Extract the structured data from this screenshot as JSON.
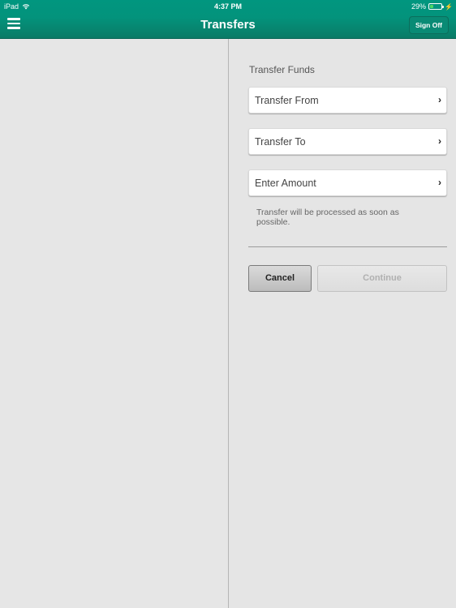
{
  "status_bar": {
    "device": "iPad",
    "time": "4:37 PM",
    "battery_percent": "29%",
    "battery_level": 0.29,
    "icons": [
      "wifi-icon",
      "battery-icon",
      "charging-bolt-icon"
    ]
  },
  "header": {
    "title": "Transfers",
    "menu_icon": "hamburger-menu-icon",
    "sign_off_label": "Sign Off"
  },
  "form": {
    "section_title": "Transfer Funds",
    "fields": [
      {
        "label": "Transfer From",
        "icon": "chevron-right-icon"
      },
      {
        "label": "Transfer To",
        "icon": "chevron-right-icon"
      },
      {
        "label": "Enter Amount",
        "icon": "chevron-right-icon"
      }
    ],
    "note": "Transfer will be processed as soon as possible.",
    "cancel_label": "Cancel",
    "continue_label": "Continue",
    "continue_enabled": false
  },
  "colors": {
    "header_green": "#03937c",
    "background": "#e5e5e5"
  }
}
